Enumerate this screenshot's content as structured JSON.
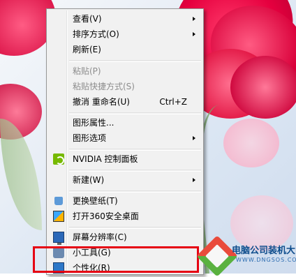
{
  "menu": {
    "items": [
      {
        "label": "查看(V)",
        "submenu": true
      },
      {
        "label": "排序方式(O)",
        "submenu": true
      },
      {
        "label": "刷新(E)"
      },
      {
        "label": "粘贴(P)",
        "disabled": true
      },
      {
        "label": "粘贴快捷方式(S)",
        "disabled": true
      },
      {
        "label": "撤消 重命名(U)",
        "shortcut": "Ctrl+Z"
      },
      {
        "label": "图形属性..."
      },
      {
        "label": "图形选项",
        "submenu": true
      },
      {
        "label": "NVIDIA 控制面板",
        "icon": "nvidia-icon"
      },
      {
        "label": "新建(W)",
        "submenu": true
      },
      {
        "label": "更换壁纸(T)",
        "icon": "shirt-icon"
      },
      {
        "label": "打开360安全桌面",
        "icon": "360-icon"
      },
      {
        "label": "屏幕分辨率(C)",
        "icon": "monitor-icon"
      },
      {
        "label": "小工具(G)",
        "icon": "gadget-icon"
      },
      {
        "label": "个性化(R)",
        "icon": "personalize-icon"
      }
    ]
  },
  "watermark": {
    "title": "电脑公司装机大师",
    "url": "WWW.DNGSOS.COM"
  },
  "colors": {
    "highlight": "#e60012",
    "menu_bg": "#f1f1f1"
  }
}
